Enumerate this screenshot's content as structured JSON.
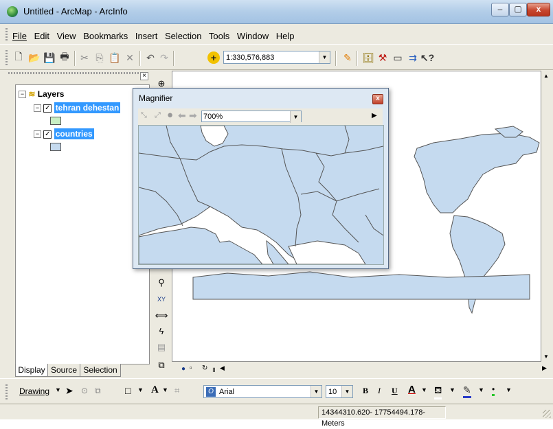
{
  "window": {
    "title": "Untitled - ArcMap - ArcInfo",
    "minimize_glyph": "–",
    "maximize_glyph": "▢",
    "close_glyph": "x"
  },
  "menu": {
    "items": [
      "File",
      "Edit",
      "View",
      "Bookmarks",
      "Insert",
      "Selection",
      "Tools",
      "Window",
      "Help"
    ]
  },
  "toolbar": {
    "scale_value": "1:330,576,883",
    "icons": [
      "new-icon",
      "open-icon",
      "save-icon",
      "print-icon",
      "cut-icon",
      "copy-icon",
      "paste-icon",
      "delete-icon",
      "undo-icon",
      "redo-icon",
      "add-data-icon",
      "editor-icon",
      "arctoolbox-icon",
      "arccatalog-icon",
      "command-line-icon",
      "model-builder-icon",
      "whats-this-icon"
    ]
  },
  "toc": {
    "close_glyph": "×",
    "root_label": "Layers",
    "layers": [
      {
        "name": "tehran dehestan",
        "checked": true,
        "swatch_color": "#c9efc3"
      },
      {
        "name": "countries",
        "checked": true,
        "swatch_color": "#c5daef"
      }
    ],
    "tabs": [
      "Display",
      "Source",
      "Selection"
    ],
    "active_tab": "Display"
  },
  "magnifier": {
    "title": "Magnifier",
    "close_glyph": "x",
    "zoom_value": "700%",
    "map_fill": "#c5daef"
  },
  "drawing": {
    "label": "Drawing",
    "font_name": "Arial",
    "font_size": "10",
    "bold": "B",
    "italic": "I",
    "underline": "U",
    "text_glyph": "A"
  },
  "status": {
    "coordinates": "14344310.620-  17754494.178- Meters"
  },
  "colors": {
    "map_fill": "#c5daef",
    "country_stroke": "#555555",
    "selection_blue": "#3399ff"
  }
}
